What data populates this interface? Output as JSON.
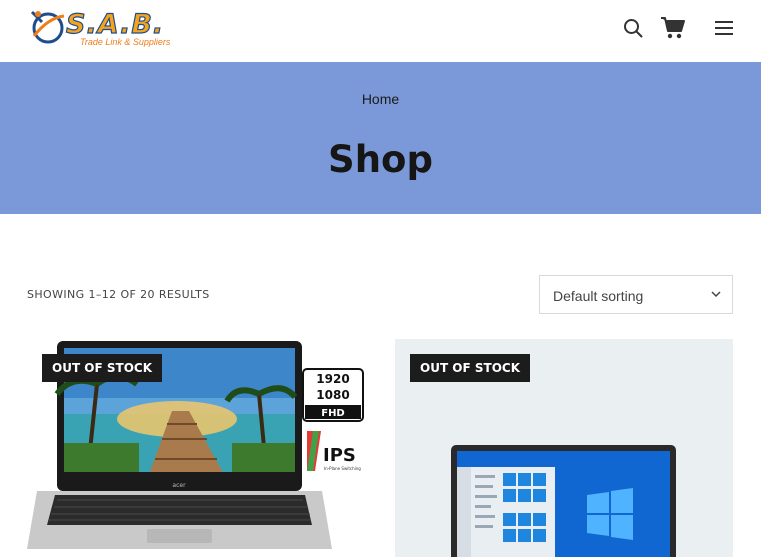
{
  "header": {
    "logo_title": "S.A.B.",
    "logo_subtitle": "Trade Link & Suppliers",
    "icons": [
      "search-icon",
      "cart-icon",
      "menu-icon"
    ]
  },
  "hero": {
    "breadcrumb": "Home",
    "title": "Shop",
    "background_color": "#7b99d9"
  },
  "shop": {
    "result_count": "SHOWING 1–12 OF 20 RESULTS",
    "sorting": {
      "selected": "Default sorting"
    }
  },
  "products": [
    {
      "badge": "OUT OF STOCK",
      "image_labels": {
        "res_top": "1920",
        "res_bottom": "1080",
        "res_tag": "FHD",
        "panel": "IPS",
        "panel_sub": "In-Plane Switching",
        "brand": "acer"
      }
    },
    {
      "badge": "OUT OF STOCK"
    }
  ],
  "colors": {
    "badge_bg": "#1c1c1c",
    "logo_orange": "#f4a41d",
    "logo_blue": "#1f4d8c"
  }
}
